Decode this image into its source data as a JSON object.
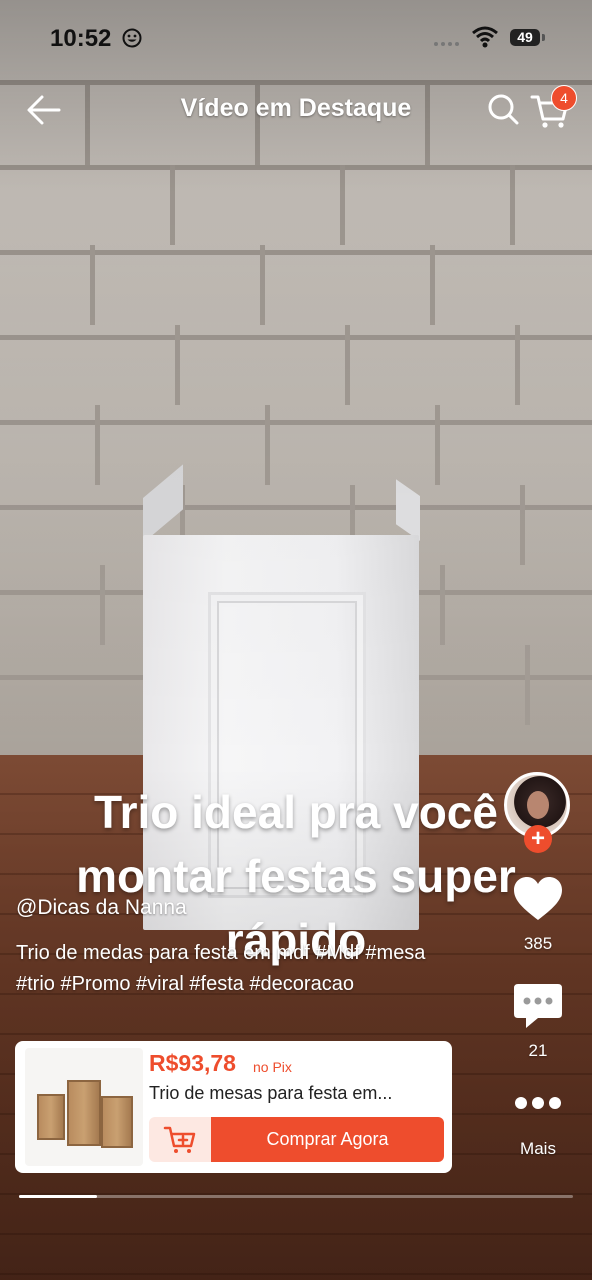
{
  "status_bar": {
    "time": "10:52",
    "battery": "49"
  },
  "header": {
    "title": "Vídeo em Destaque",
    "cart_count": "4"
  },
  "video": {
    "caption": "Trio ideal pra você montar festas super rápido",
    "author": "@Dicas da Nanna",
    "description": "Trio de medas para festa em mdf #Mdf #mesa #trio #Promo #viral #festa #decoracao",
    "progress": 0.14
  },
  "actions": {
    "likes": "385",
    "comments": "21",
    "more_label": "Mais"
  },
  "product": {
    "price": "R$93,78",
    "price_suffix": "no Pix",
    "name": "Trio de mesas para festa em...",
    "buy_label": "Comprar Agora"
  },
  "colors": {
    "accent": "#ee4d2d"
  }
}
